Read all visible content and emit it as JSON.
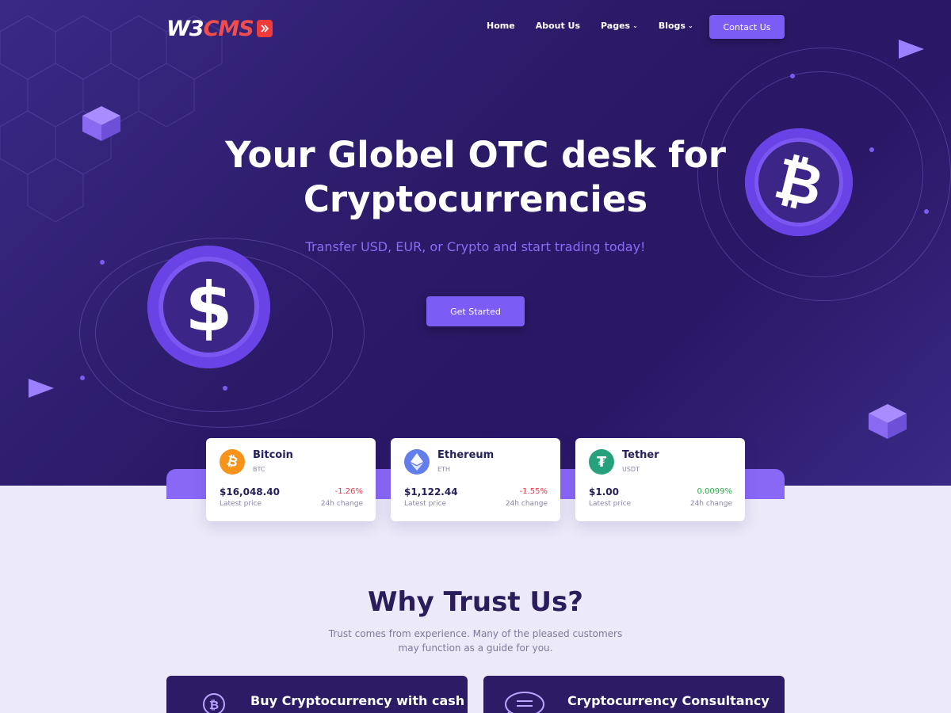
{
  "brand": {
    "logo_text": "W3",
    "logo_text_red": "CMS"
  },
  "nav": {
    "items": [
      {
        "label": "Home",
        "has_dropdown": false
      },
      {
        "label": "About Us",
        "has_dropdown": false
      },
      {
        "label": "Pages",
        "has_dropdown": true
      },
      {
        "label": "Blogs",
        "has_dropdown": true
      }
    ],
    "contact_label": "Contact Us"
  },
  "hero": {
    "title_line1": "Your Globel OTC desk for",
    "title_line2": "Cryptocurrencies",
    "subtitle": "Transfer USD, EUR, or Crypto and start trading today!",
    "cta_label": "Get Started"
  },
  "tickers": [
    {
      "name": "Bitcoin",
      "symbol": "BTC",
      "price": "$16,048.40",
      "price_label": "Latest price",
      "change": "-1.26%",
      "change_label": "24h change",
      "icon": "bitcoin-icon",
      "color": "#f7931a"
    },
    {
      "name": "Ethereum",
      "symbol": "ETH",
      "price": "$1,122.44",
      "price_label": "Latest price",
      "change": "-1.55%",
      "change_label": "24h change",
      "icon": "ethereum-icon",
      "color": "#627eea"
    },
    {
      "name": "Tether",
      "symbol": "USDT",
      "price": "$1.00",
      "price_label": "Latest price",
      "change": "0.0099%",
      "change_label": "24h change",
      "icon": "tether-icon",
      "color": "#26a17b"
    }
  ],
  "trust": {
    "title": "Why Trust Us?",
    "subtitle_line1": "Trust comes from experience. Many of the pleased customers",
    "subtitle_line2": "may function as a guide for you."
  },
  "features": [
    {
      "title": "Buy Cryptocurrency with cash",
      "icon": "bitcoin-cash-icon"
    },
    {
      "title": "Cryptocurrency Consultancy",
      "icon": "chat-bubble-icon"
    }
  ],
  "colors": {
    "accent": "#7b5cf5",
    "hero_bg": "#2b1a67",
    "negative": "#e53b4f",
    "positive": "#2fa84b"
  }
}
